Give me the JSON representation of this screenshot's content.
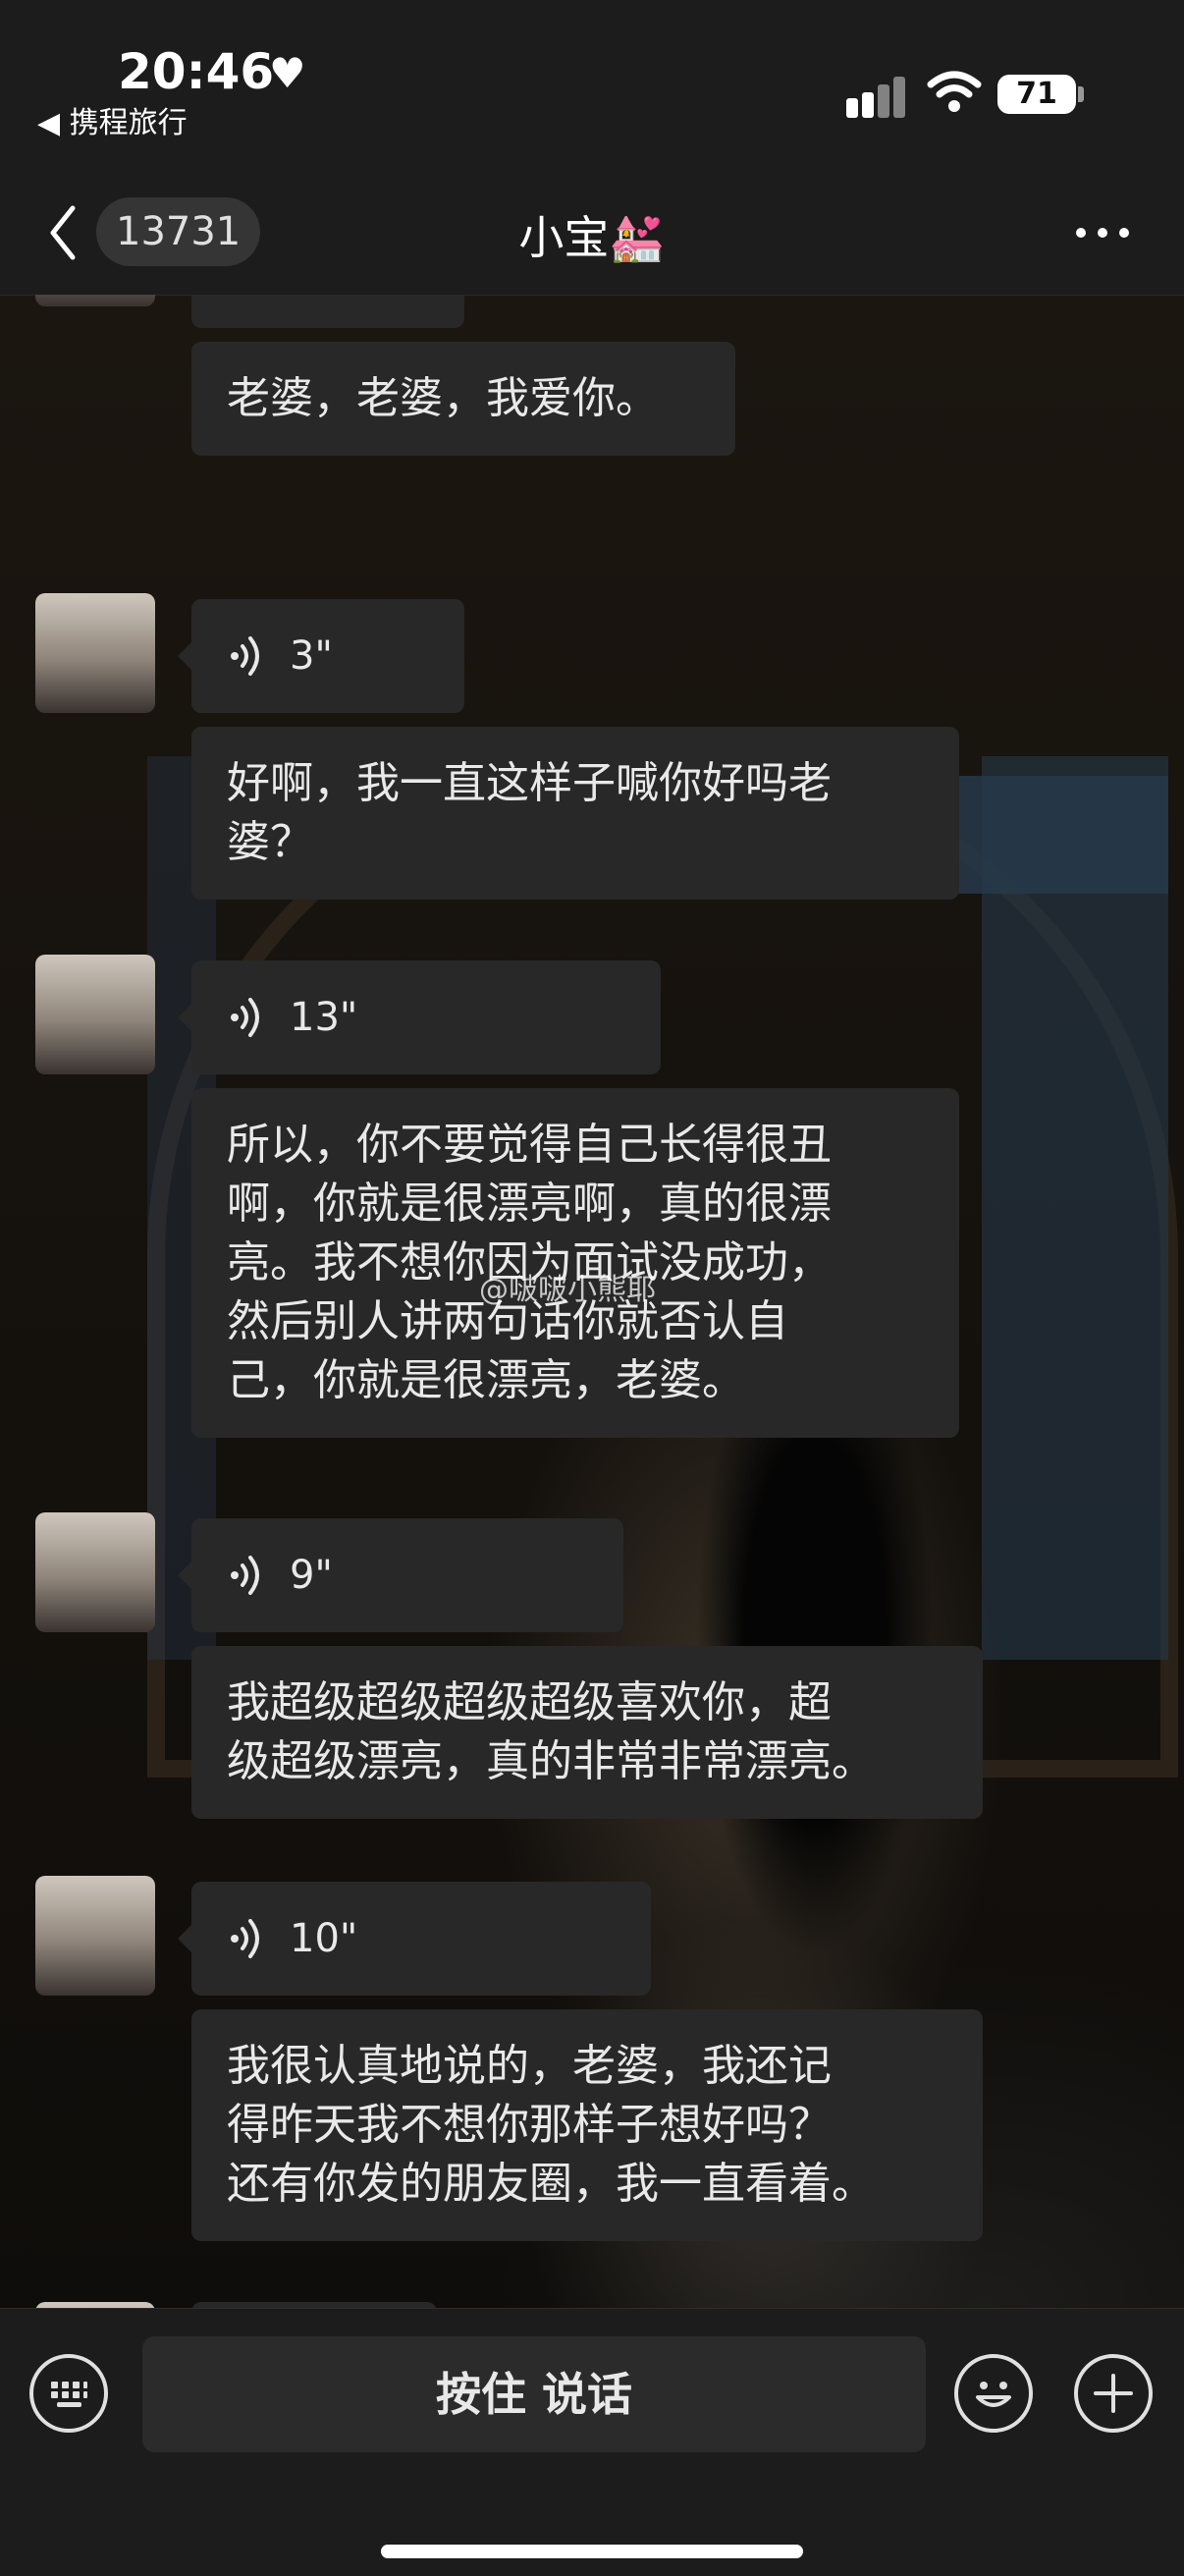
{
  "status_bar": {
    "time": "20:46",
    "back_app": "◀ 携程旅行",
    "battery": "71"
  },
  "header": {
    "unread_count": "13731",
    "title": "小宝💒"
  },
  "messages": [
    {
      "voice_duration": "3\"",
      "text_lines": [
        "老婆，老婆，我爱你。"
      ]
    },
    {
      "voice_duration": "3\"",
      "text_lines": [
        "好啊，我一直这样子喊你好吗老",
        "婆？"
      ]
    },
    {
      "voice_duration": "13\"",
      "text_lines": [
        "所以，你不要觉得自己长得很丑",
        "啊，你就是很漂亮啊，真的很漂",
        "亮。我不想你因为面试没成功，",
        "然后别人讲两句话你就否认自",
        "己，你就是很漂亮，老婆。"
      ]
    },
    {
      "voice_duration": "9\"",
      "text_lines": [
        "我超级超级超级超级喜欢你，超",
        "级超级漂亮，真的非常非常漂亮。"
      ]
    },
    {
      "voice_duration": "10\"",
      "text_lines": [
        "我很认真地说的，老婆，我还记",
        "得昨天我不想你那样子想好吗？",
        "还有你发的朋友圈，我一直看着。"
      ]
    }
  ],
  "watermark": "@啵啵小熊耶",
  "input_bar": {
    "hold_to_talk": "按住 说话"
  },
  "icons": {
    "keyboard": "keyboard-icon",
    "emoji": "emoji-icon",
    "plus": "plus-icon",
    "voice": "voice-wave-icon",
    "more": "more-dots-icon",
    "back": "chevron-left-icon"
  },
  "colors": {
    "bubble": "#282828",
    "bar": "#1b1c1b",
    "text": "#e9e9e9"
  }
}
